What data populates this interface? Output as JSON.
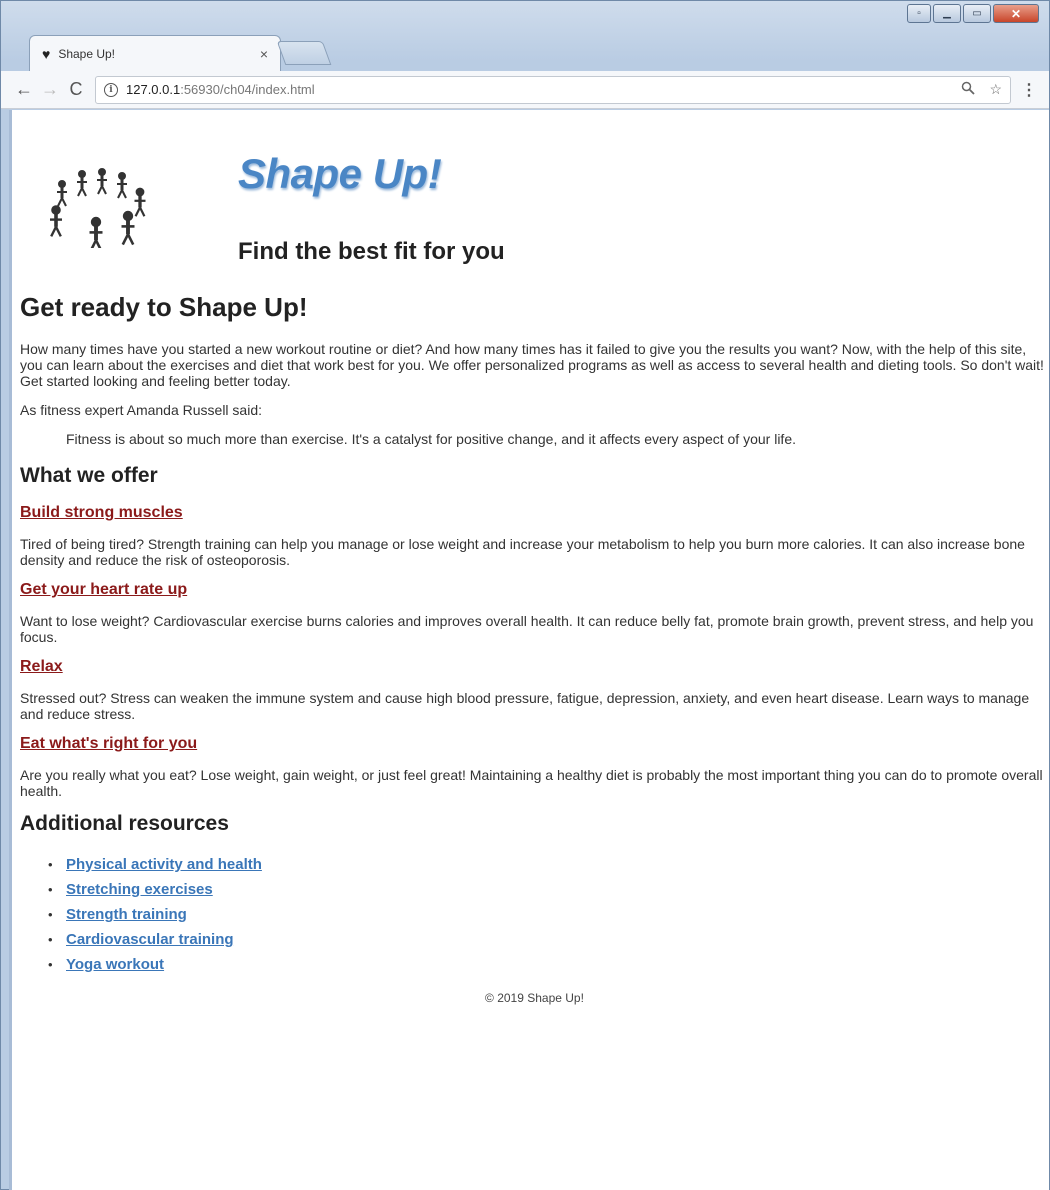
{
  "browser": {
    "tab_title": "Shape Up!",
    "tab_close": "×",
    "url_host": "127.0.0.1",
    "url_rest": ":56930/ch04/index.html",
    "back_icon": "←",
    "forward_icon": "→",
    "reload_icon": "C",
    "zoom_icon": "🔍",
    "star_icon": "☆",
    "menu_icon": "⋮",
    "min_icon": "▁",
    "max_icon": "▭",
    "close_icon": "✕"
  },
  "header": {
    "brand": "Shape Up!",
    "tagline": "Find the best fit for you"
  },
  "intro": {
    "heading": "Get ready to Shape Up!",
    "paragraph": "How many times have you started a new workout routine or diet? And how many times has it failed to give you the results you want? Now, with the help of this site, you can learn about the exercises and diet that work best for you. We offer personalized programs as well as access to several health and dieting tools. So don't wait! Get started looking and feeling better today.",
    "quote_intro": "As fitness expert Amanda Russell said:",
    "quote": "Fitness is about so much more than exercise. It's a catalyst for positive change, and it affects every aspect of your life."
  },
  "offer": {
    "heading": "What we offer",
    "items": [
      {
        "title": "Build strong muscles",
        "text": "Tired of being tired? Strength training can help you manage or lose weight and increase your metabolism to help you burn more calories. It can also increase bone density and reduce the risk of osteoporosis."
      },
      {
        "title": "Get your heart rate up",
        "text": "Want to lose weight? Cardiovascular exercise burns calories and improves overall health. It can reduce belly fat, promote brain growth, prevent stress, and help you focus."
      },
      {
        "title": "Relax",
        "text": "Stressed out? Stress can weaken the immune system and cause high blood pressure, fatigue, depression, anxiety, and even heart disease. Learn ways to manage and reduce stress."
      },
      {
        "title": "Eat what's right for you",
        "text": "Are you really what you eat? Lose weight, gain weight, or just feel great! Maintaining a healthy diet is probably the most important thing you can do to promote overall health."
      }
    ]
  },
  "resources": {
    "heading": "Additional resources",
    "links": [
      "Physical activity and health",
      "Stretching exercises",
      "Strength training",
      "Cardiovascular training",
      "Yoga workout"
    ]
  },
  "footer": {
    "text": "© 2019 Shape Up!"
  }
}
